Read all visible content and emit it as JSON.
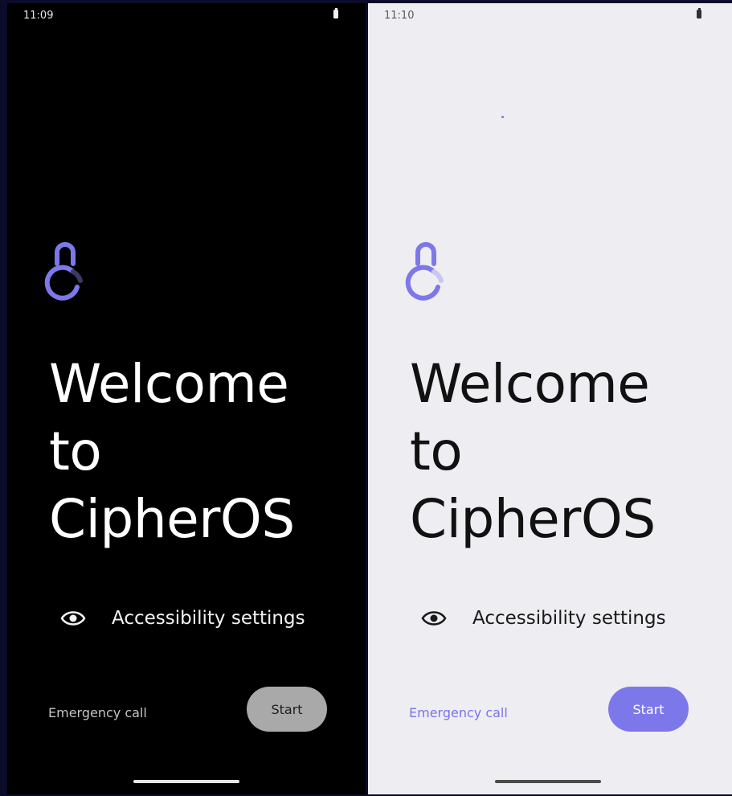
{
  "colors": {
    "accent": "#7d78ea",
    "dark_background": "#000000",
    "light_background": "#eeedf1",
    "dark_start_button": "#a9a9a9"
  },
  "dark_screen": {
    "status_time": "11:09",
    "battery_icon": "battery-icon",
    "lock_icon": "lock-icon",
    "welcome_title": "Welcome\nto\nCipherOS",
    "accessibility_icon": "eye-icon",
    "accessibility_label": "Accessibility settings",
    "emergency_call": "Emergency call",
    "start_label": "Start"
  },
  "light_screen": {
    "status_time": "11:10",
    "battery_icon": "battery-icon",
    "lock_icon": "lock-icon",
    "welcome_title": "Welcome\nto\nCipherOS",
    "accessibility_icon": "eye-icon",
    "accessibility_label": "Accessibility settings",
    "emergency_call": "Emergency call",
    "start_label": "Start"
  }
}
